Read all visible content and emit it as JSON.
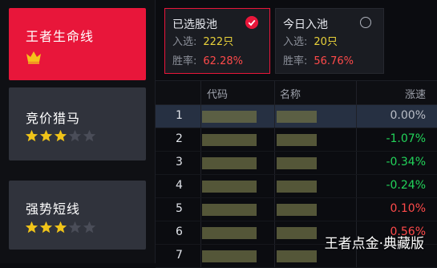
{
  "sidebar": {
    "cards": [
      {
        "title": "王者生命线",
        "badge": "crown-icon"
      },
      {
        "title": "竞价猎马",
        "stars_filled": 3,
        "stars_total": 5
      },
      {
        "title": "强势短线",
        "stars_filled": 3,
        "stars_total": 5
      }
    ]
  },
  "pools": [
    {
      "title": "已选股池",
      "selected": true,
      "entry_label": "入选:",
      "entry_value": "222只",
      "win_label": "胜率:",
      "win_value": "62.28%"
    },
    {
      "title": "今日入池",
      "selected": false,
      "entry_label": "入选:",
      "entry_value": "20只",
      "win_label": "胜率:",
      "win_value": "56.76%"
    }
  ],
  "table": {
    "headers": {
      "code": "代码",
      "name": "名称",
      "change": "涨速"
    },
    "rows": [
      {
        "idx": "1",
        "change": "0.00%",
        "tone": "flat"
      },
      {
        "idx": "2",
        "change": "-1.07%",
        "tone": "down"
      },
      {
        "idx": "3",
        "change": "-0.34%",
        "tone": "down"
      },
      {
        "idx": "4",
        "change": "-0.24%",
        "tone": "down"
      },
      {
        "idx": "5",
        "change": "0.10%",
        "tone": "up"
      },
      {
        "idx": "6",
        "change": "0.56%",
        "tone": "up"
      },
      {
        "idx": "7",
        "change": "",
        "tone": "up"
      }
    ]
  },
  "colors": {
    "accent": "#e8163a",
    "up": "#ff4a4a",
    "down": "#22d45a",
    "flat": "#b9bdc6",
    "star": "#f0c419"
  },
  "watermark": "王者点金·典藏版"
}
